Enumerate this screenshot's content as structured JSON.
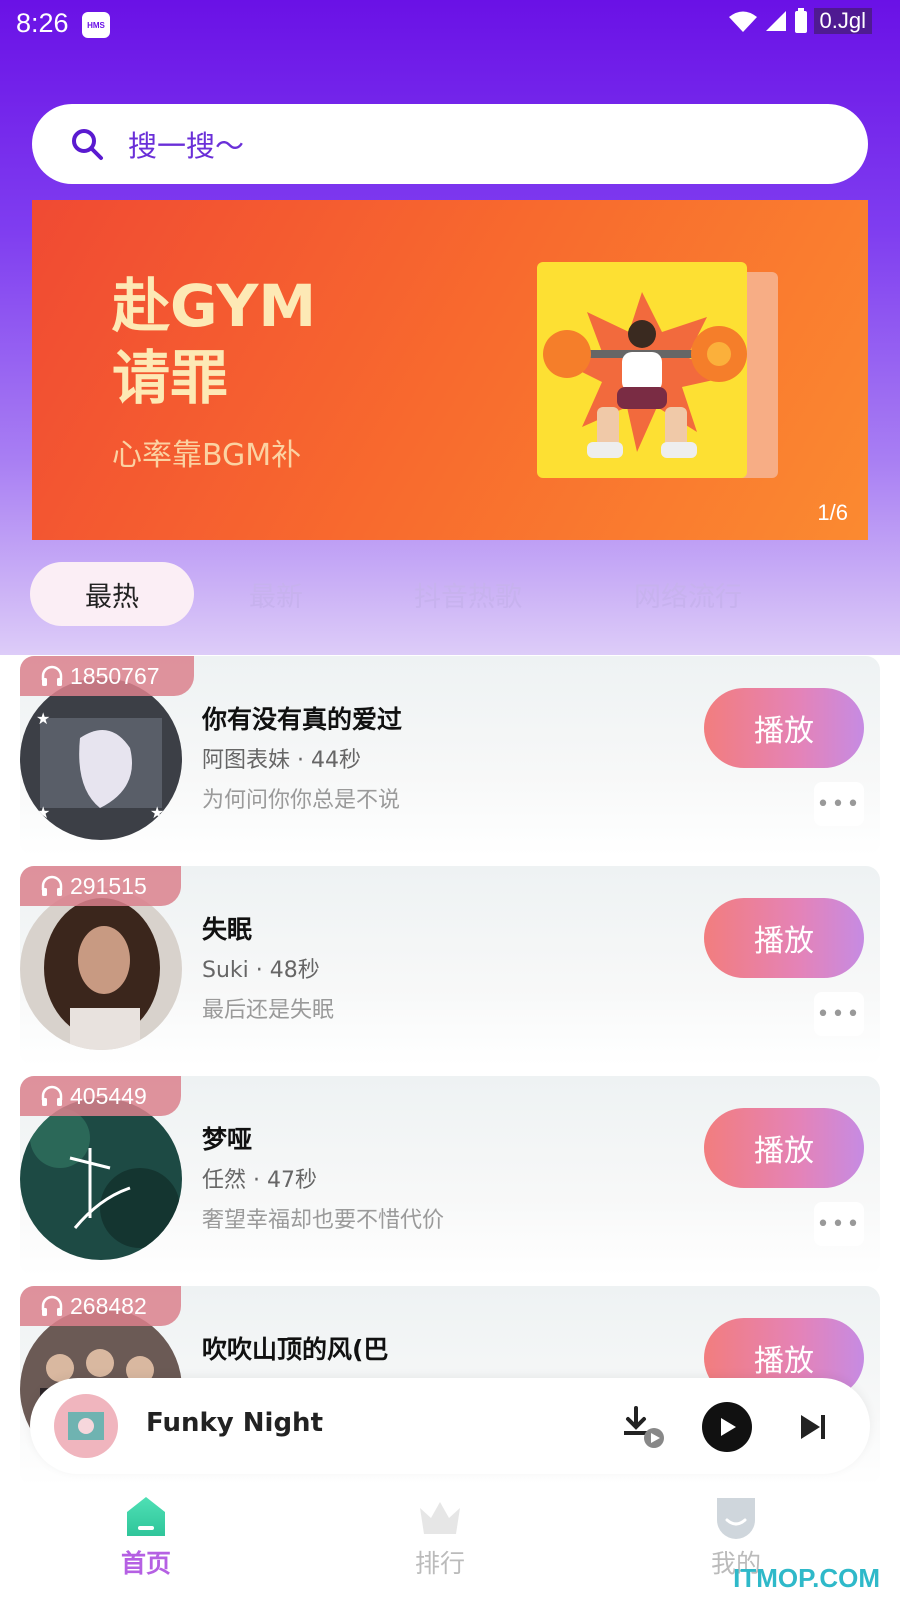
{
  "status_bar": {
    "time": "8:26",
    "hms": "HMS",
    "carrier": "0.Jgl"
  },
  "search": {
    "placeholder": "搜一搜～"
  },
  "banner": {
    "title_line1": "赴GYM",
    "title_line2": "请罪",
    "subtitle": "心率靠BGM补",
    "counter": "1/6"
  },
  "tabs": [
    {
      "label": "最热",
      "active": true
    },
    {
      "label": "最新",
      "active": false
    },
    {
      "label": "抖音热歌",
      "active": false
    },
    {
      "label": "网络流行",
      "active": false
    }
  ],
  "songs": [
    {
      "plays": "1850767",
      "title": "你有没有真的爱过",
      "meta": "阿图表妹 · 44秒",
      "desc": "为何问你你总是不说",
      "action": "播放",
      "more": "•••"
    },
    {
      "plays": "291515",
      "title": "失眠",
      "meta": "Suki · 48秒",
      "desc": "最后还是失眠",
      "action": "播放",
      "more": "•••"
    },
    {
      "plays": "405449",
      "title": "梦哑",
      "meta": "任然 · 47秒",
      "desc": "奢望幸福却也要不惜代价",
      "action": "播放",
      "more": "•••"
    },
    {
      "plays": "268482",
      "title": "吹吹山顶的风(巴",
      "meta": "",
      "desc": "",
      "action": "播放",
      "more": ""
    }
  ],
  "player": {
    "title": "Funky Night"
  },
  "nav": [
    {
      "label": "首页",
      "active": true
    },
    {
      "label": "排行",
      "active": false
    },
    {
      "label": "我的",
      "active": false
    }
  ],
  "watermark": "ITMOP.COM",
  "colors": {
    "header_purple": "#6a11e6",
    "play_gradient_start": "#f27d7e",
    "play_gradient_end": "#c68be3",
    "active_tab_text": "#b560e3"
  },
  "icons": [
    "search-icon",
    "headphones-icon",
    "download-icon",
    "play-icon",
    "next-icon",
    "home-icon",
    "crown-icon",
    "profile-icon",
    "wifi-icon",
    "signal-icon",
    "battery-icon"
  ]
}
